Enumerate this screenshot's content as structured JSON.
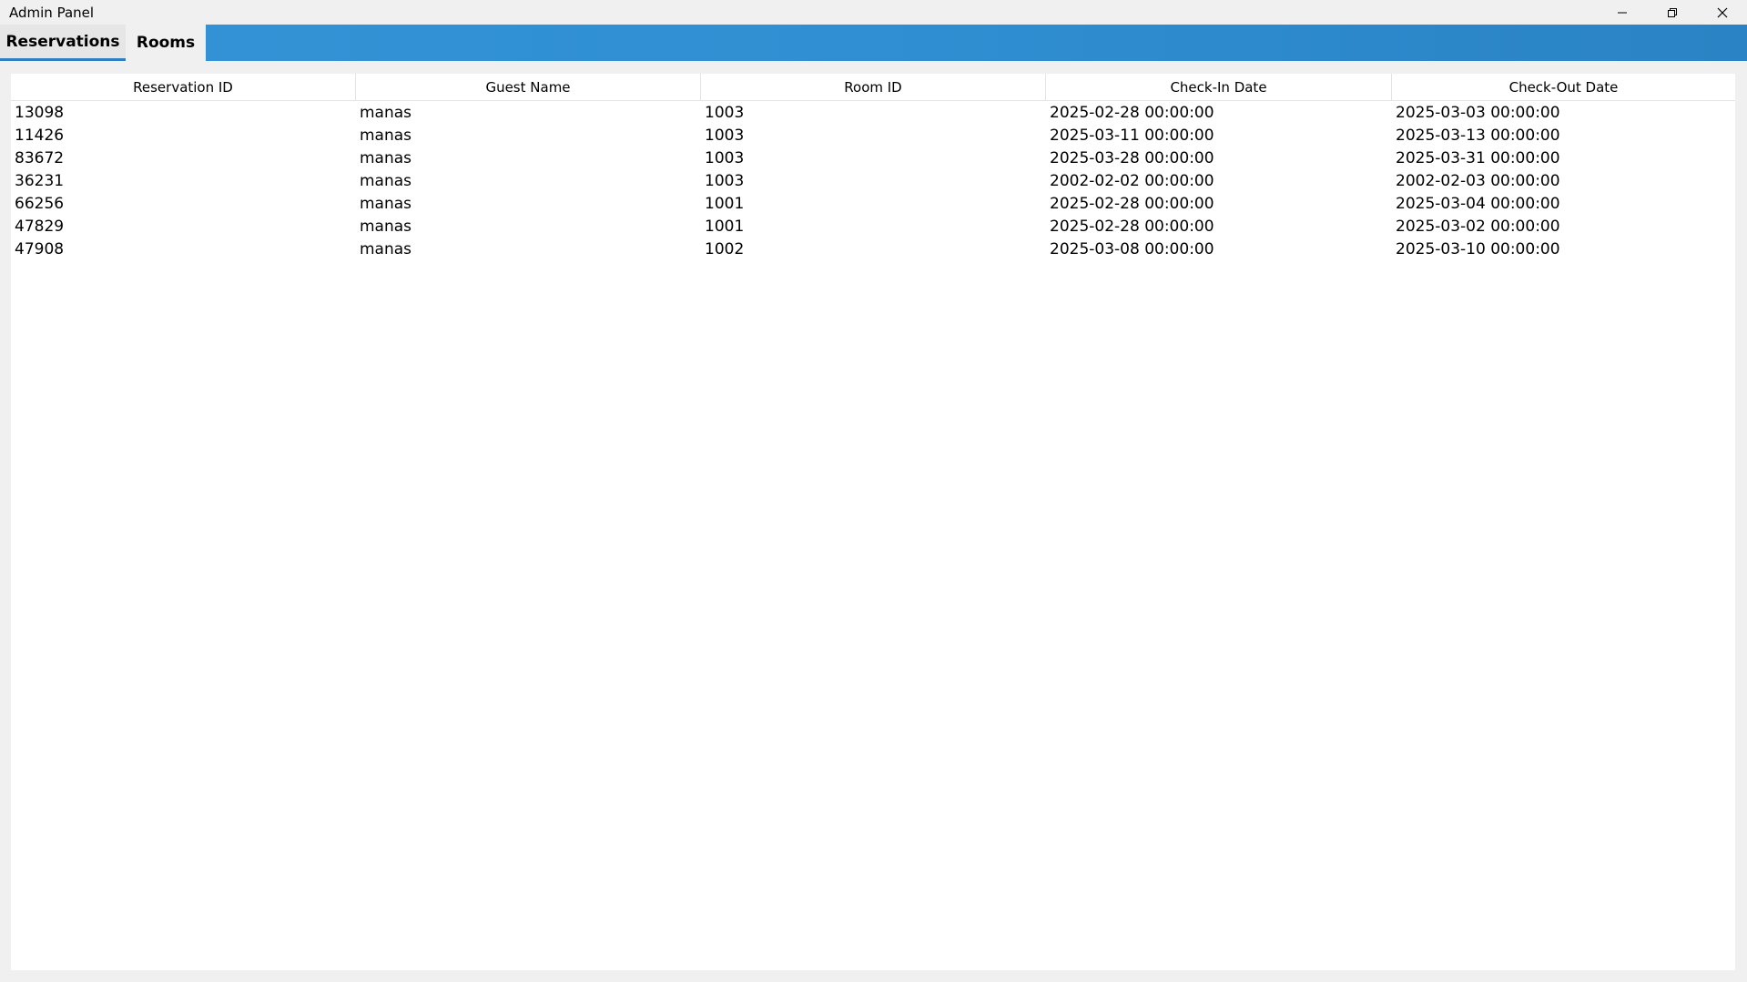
{
  "window": {
    "title": "Admin Panel",
    "controls": {
      "minimize_icon": "minimize-icon",
      "maximize_icon": "restore-icon",
      "close_icon": "close-icon"
    }
  },
  "tabs": [
    {
      "label": "Reservations",
      "active": true
    },
    {
      "label": "Rooms",
      "active": false
    }
  ],
  "colors": {
    "tabbar": "#3393d6",
    "active_tab": "#e6e6e6",
    "active_underline": "#2d7fc1"
  },
  "table": {
    "columns": [
      "Reservation ID",
      "Guest Name",
      "Room ID",
      "Check-In Date",
      "Check-Out Date"
    ],
    "rows": [
      [
        "13098",
        "manas",
        "1003",
        "2025-02-28 00:00:00",
        "2025-03-03 00:00:00"
      ],
      [
        "11426",
        "manas",
        "1003",
        "2025-03-11 00:00:00",
        "2025-03-13 00:00:00"
      ],
      [
        "83672",
        "manas",
        "1003",
        "2025-03-28 00:00:00",
        "2025-03-31 00:00:00"
      ],
      [
        "36231",
        "manas",
        "1003",
        "2002-02-02 00:00:00",
        "2002-02-03 00:00:00"
      ],
      [
        "66256",
        "manas",
        "1001",
        "2025-02-28 00:00:00",
        "2025-03-04 00:00:00"
      ],
      [
        "47829",
        "manas",
        "1001",
        "2025-02-28 00:00:00",
        "2025-03-02 00:00:00"
      ],
      [
        "47908",
        "manas",
        "1002",
        "2025-03-08 00:00:00",
        "2025-03-10 00:00:00"
      ]
    ]
  }
}
